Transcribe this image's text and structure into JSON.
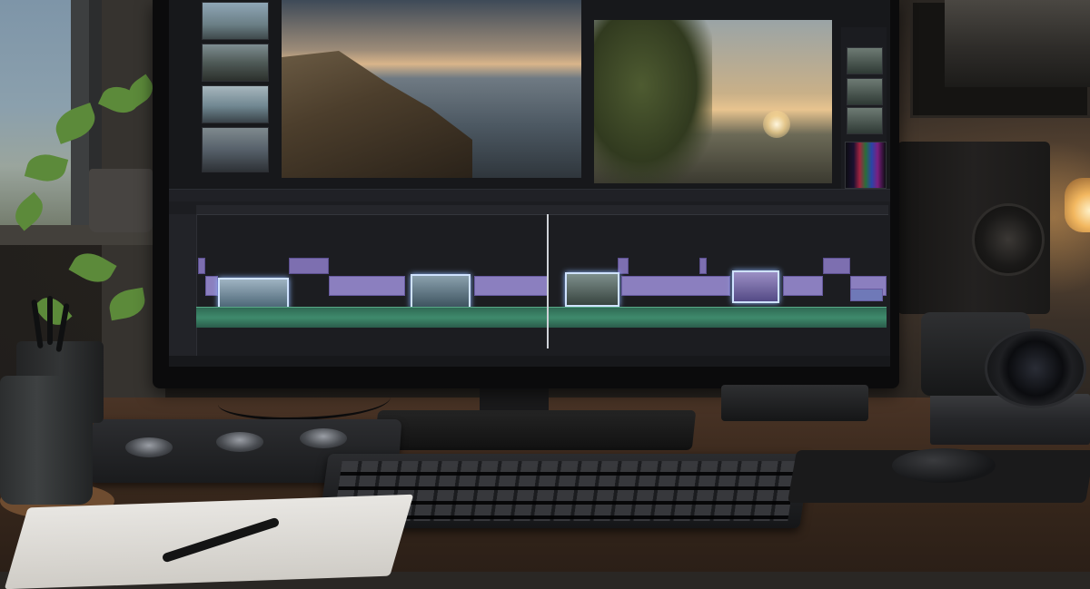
{
  "scene": {
    "description_tags": [
      "video-editing-workstation",
      "desk",
      "monitor",
      "timeline"
    ]
  },
  "colors": {
    "clip_video": "#8b7fbf",
    "clip_selected_outline": "#cfe2ff",
    "audio_track": "#3f8a6c",
    "playhead": "#cfd2d8",
    "desk_wood": "#3a291d",
    "lamp_glow": "#f2b75f"
  },
  "timeline": {
    "playhead_position": 0.52,
    "track_count": 4
  }
}
